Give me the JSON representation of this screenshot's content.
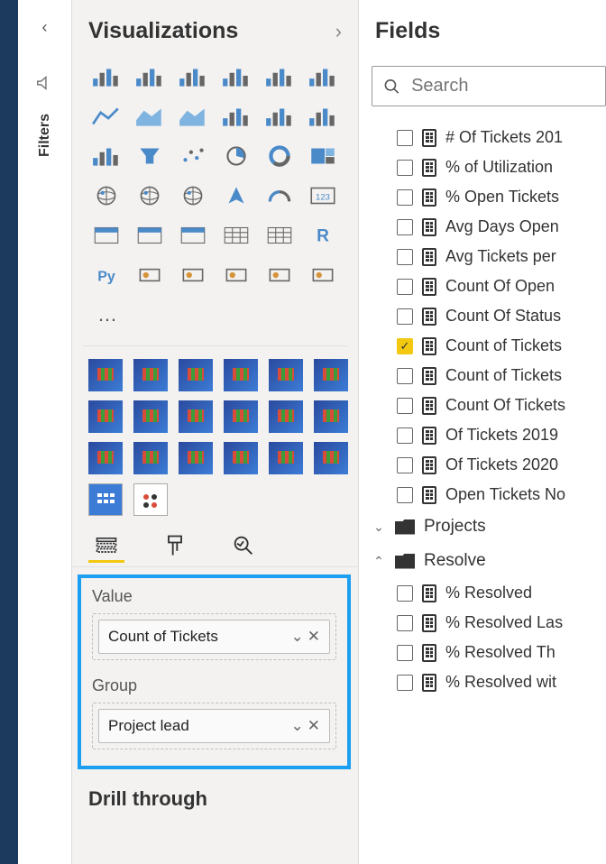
{
  "rail": {
    "filters_label": "Filters"
  },
  "visualizations": {
    "title": "Visualizations",
    "icons": [
      "stacked-bar",
      "clustered-bar",
      "stacked-column",
      "clustered-column",
      "100-stacked-bar",
      "100-stacked-column",
      "line",
      "area",
      "stacked-area",
      "line-clustered-column",
      "line-stacked-column",
      "ribbon",
      "waterfall",
      "funnel",
      "scatter",
      "pie",
      "donut",
      "treemap",
      "map",
      "filled-map",
      "shape-map",
      "azure-map",
      "gauge",
      "card",
      "multi-row-card",
      "kpi",
      "slicer",
      "table",
      "matrix",
      "r-visual",
      "py-visual",
      "key-influencers",
      "decomposition-tree",
      "qa",
      "narrative",
      "paginated"
    ],
    "more": "…"
  },
  "tabs": {
    "fields_tab": "Fields",
    "format_tab": "Format",
    "analytics_tab": "Analytics"
  },
  "wells": {
    "value_label": "Value",
    "value_field": "Count of Tickets",
    "group_label": "Group",
    "group_field": "Project lead"
  },
  "drill": {
    "title": "Drill through"
  },
  "fields": {
    "title": "Fields",
    "search_placeholder": "Search",
    "items": [
      {
        "label": "# Of Tickets 201",
        "checked": false
      },
      {
        "label": "% of Utilization",
        "checked": false
      },
      {
        "label": "% Open Tickets",
        "checked": false
      },
      {
        "label": "Avg Days Open",
        "checked": false
      },
      {
        "label": "Avg Tickets per",
        "checked": false
      },
      {
        "label": "Count Of Open",
        "checked": false
      },
      {
        "label": "Count Of Status",
        "checked": false
      },
      {
        "label": "Count of Tickets",
        "checked": true
      },
      {
        "label": "Count of Tickets",
        "checked": false
      },
      {
        "label": "Count Of Tickets",
        "checked": false
      },
      {
        "label": "Of Tickets 2019",
        "checked": false
      },
      {
        "label": "Of Tickets 2020",
        "checked": false
      },
      {
        "label": "Open Tickets No",
        "checked": false
      }
    ],
    "folders": {
      "projects": "Projects",
      "resolve": "Resolve",
      "resolve_items": [
        {
          "label": "% Resolved",
          "checked": false
        },
        {
          "label": "% Resolved Las",
          "checked": false
        },
        {
          "label": "% Resolved Th",
          "checked": false
        },
        {
          "label": "% Resolved wit",
          "checked": false
        }
      ]
    }
  }
}
